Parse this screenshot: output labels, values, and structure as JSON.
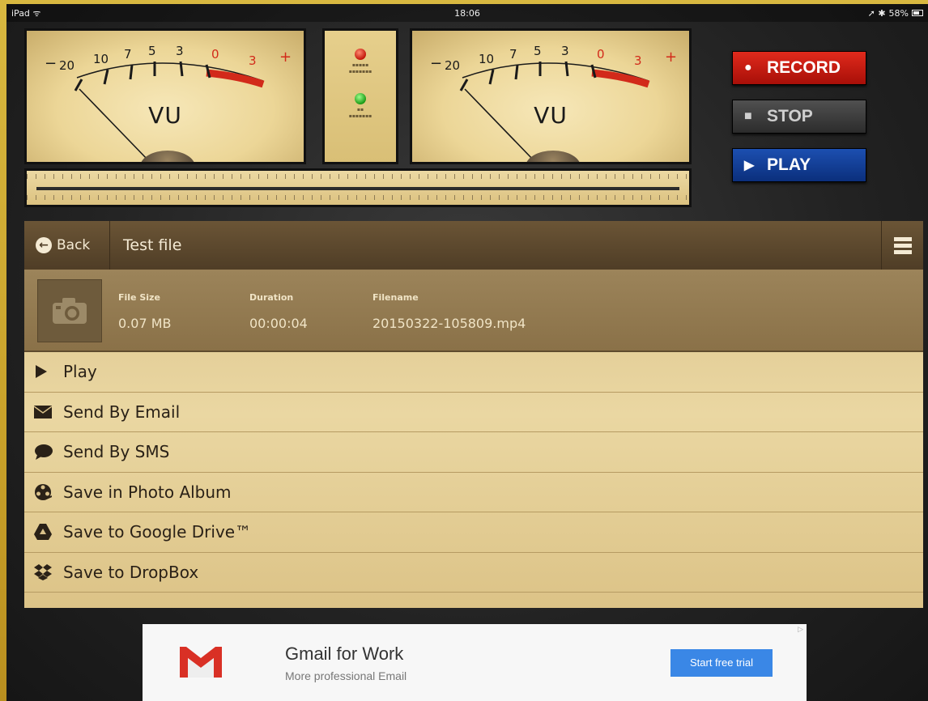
{
  "status_bar": {
    "device": "iPad ᯤ",
    "time": "18:06",
    "battery": "58%",
    "indicators": "➚ ✱"
  },
  "vu_meters": {
    "label": "VU",
    "scale": [
      "20",
      "10",
      "7",
      "5",
      "3",
      "0",
      "3"
    ],
    "minus": "−",
    "plus": "+"
  },
  "transport": {
    "record": "RECORD",
    "stop": "STOP",
    "play": "PLAY"
  },
  "panel": {
    "back_label": "Back",
    "title": "Test file"
  },
  "file": {
    "size_label": "File Size",
    "size_value": "0.07 MB",
    "duration_label": "Duration",
    "duration_value": "00:00:04",
    "filename_label": "Filename",
    "filename_value": "20150322-105809.mp4"
  },
  "actions": [
    {
      "label": "Play",
      "icon": "play-icon"
    },
    {
      "label": "Send By Email",
      "icon": "envelope-icon"
    },
    {
      "label": "Send By SMS",
      "icon": "chat-bubble-icon"
    },
    {
      "label": "Save in Photo Album",
      "icon": "film-reel-icon"
    },
    {
      "label": "Save to Google Drive™",
      "icon": "google-drive-icon"
    },
    {
      "label": "Save to DropBox",
      "icon": "dropbox-icon"
    }
  ],
  "ad": {
    "title": "Gmail for Work",
    "subtitle": "More professional Email",
    "cta": "Start free trial"
  },
  "colors": {
    "record": "#c41a10",
    "play": "#0f3a92",
    "panel_header": "#5c4830",
    "ad_button": "#3a87e6"
  }
}
